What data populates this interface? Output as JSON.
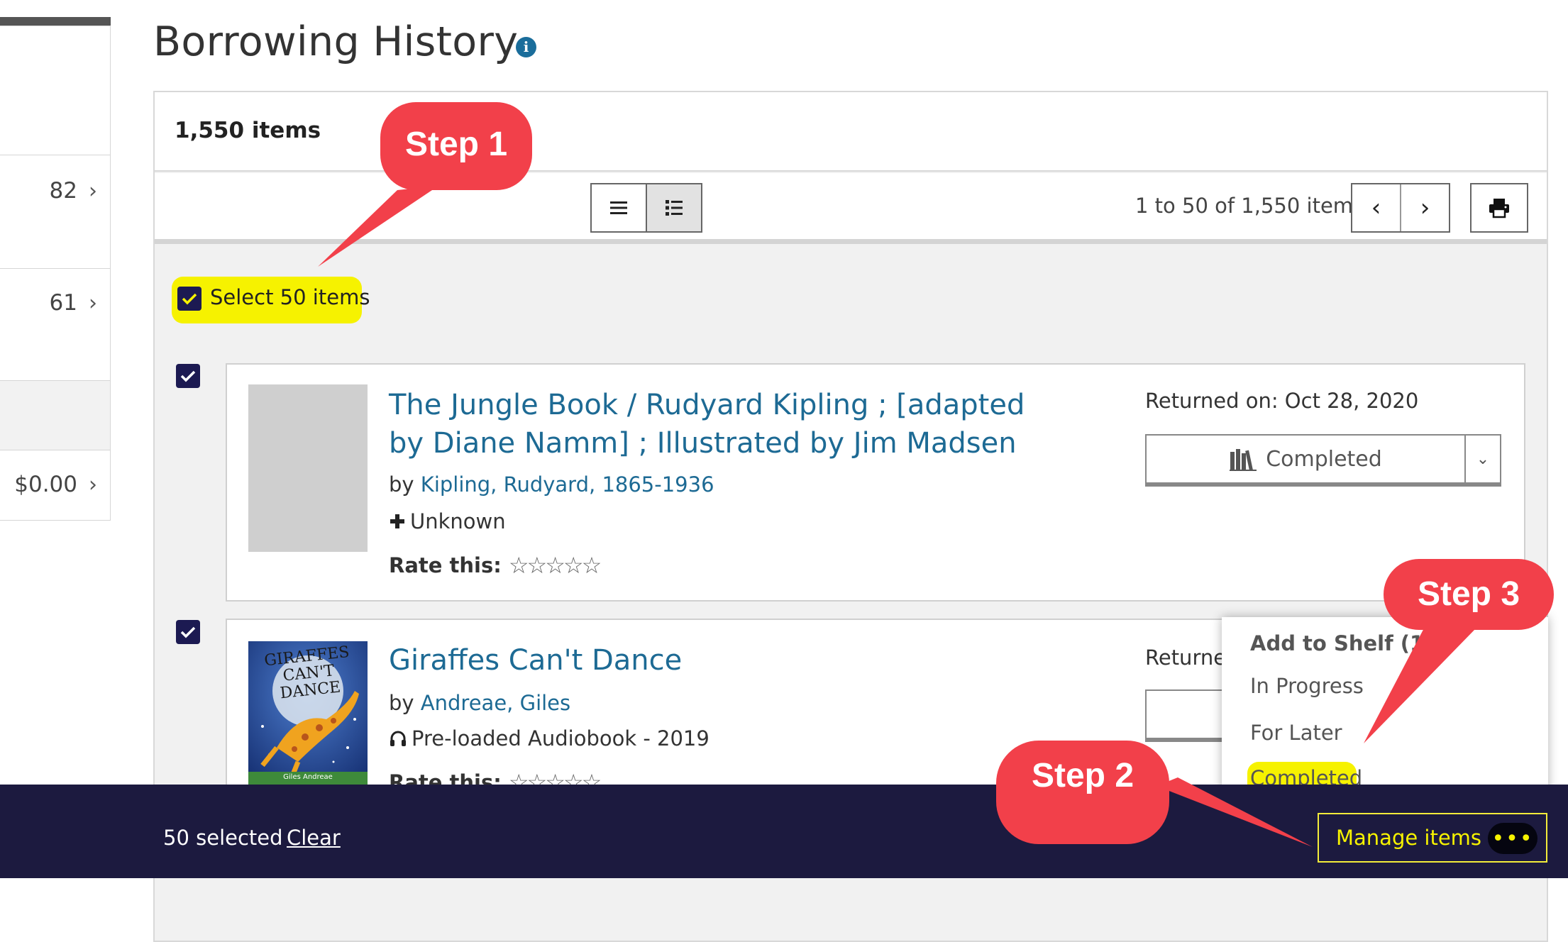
{
  "sidebar": {
    "counts": [
      {
        "value": "82"
      },
      {
        "value": "61"
      },
      {
        "value": "$0.00"
      }
    ]
  },
  "page": {
    "title": "Borrowing History"
  },
  "results": {
    "total_label": "1,550 items",
    "pagination_label": "1 to 50 of 1,550 items",
    "select_all_label": "Select 50 items"
  },
  "items": [
    {
      "title": "The Jungle Book / Rudyard Kipling ; [adapted by Diane Namm] ; Illustrated by Jim Madsen",
      "by_prefix": "by",
      "author": "Kipling, Rudyard, 1865-1936",
      "format": "Unknown",
      "rate_label": "Rate this:",
      "stars": "☆☆☆☆☆",
      "returned": "Returned on: Oct 28, 2020",
      "shelf_status": "Completed",
      "checked": true
    },
    {
      "title": "Giraffes Can't Dance",
      "by_prefix": "by",
      "author": "Andreae, Giles",
      "format": "Pre-loaded Audiobook - 2019",
      "rate_label": "Rate this:",
      "stars": "☆☆☆☆☆",
      "returned": "Returne",
      "cover_text": "GIRAFFES CAN'T DANCE",
      "cover_author": "Giles Andreae",
      "checked": true
    }
  ],
  "dropdown": {
    "header": "Add to Shelf (1)",
    "options": [
      "In Progress",
      "For Later",
      "Completed"
    ],
    "highlighted": "Completed"
  },
  "bottom_bar": {
    "selected_label": "50 selected",
    "clear_label": "Clear",
    "manage_label": "Manage items",
    "more_label": "•••"
  },
  "callouts": {
    "step1": "Step 1",
    "step2": "Step 2",
    "step3": "Step 3",
    "color": "#f2404a"
  },
  "colors": {
    "link": "#1d6a94",
    "highlight": "#f6f200",
    "bottom_bar": "#1c1a3f",
    "checkbox": "#1c1a52"
  }
}
